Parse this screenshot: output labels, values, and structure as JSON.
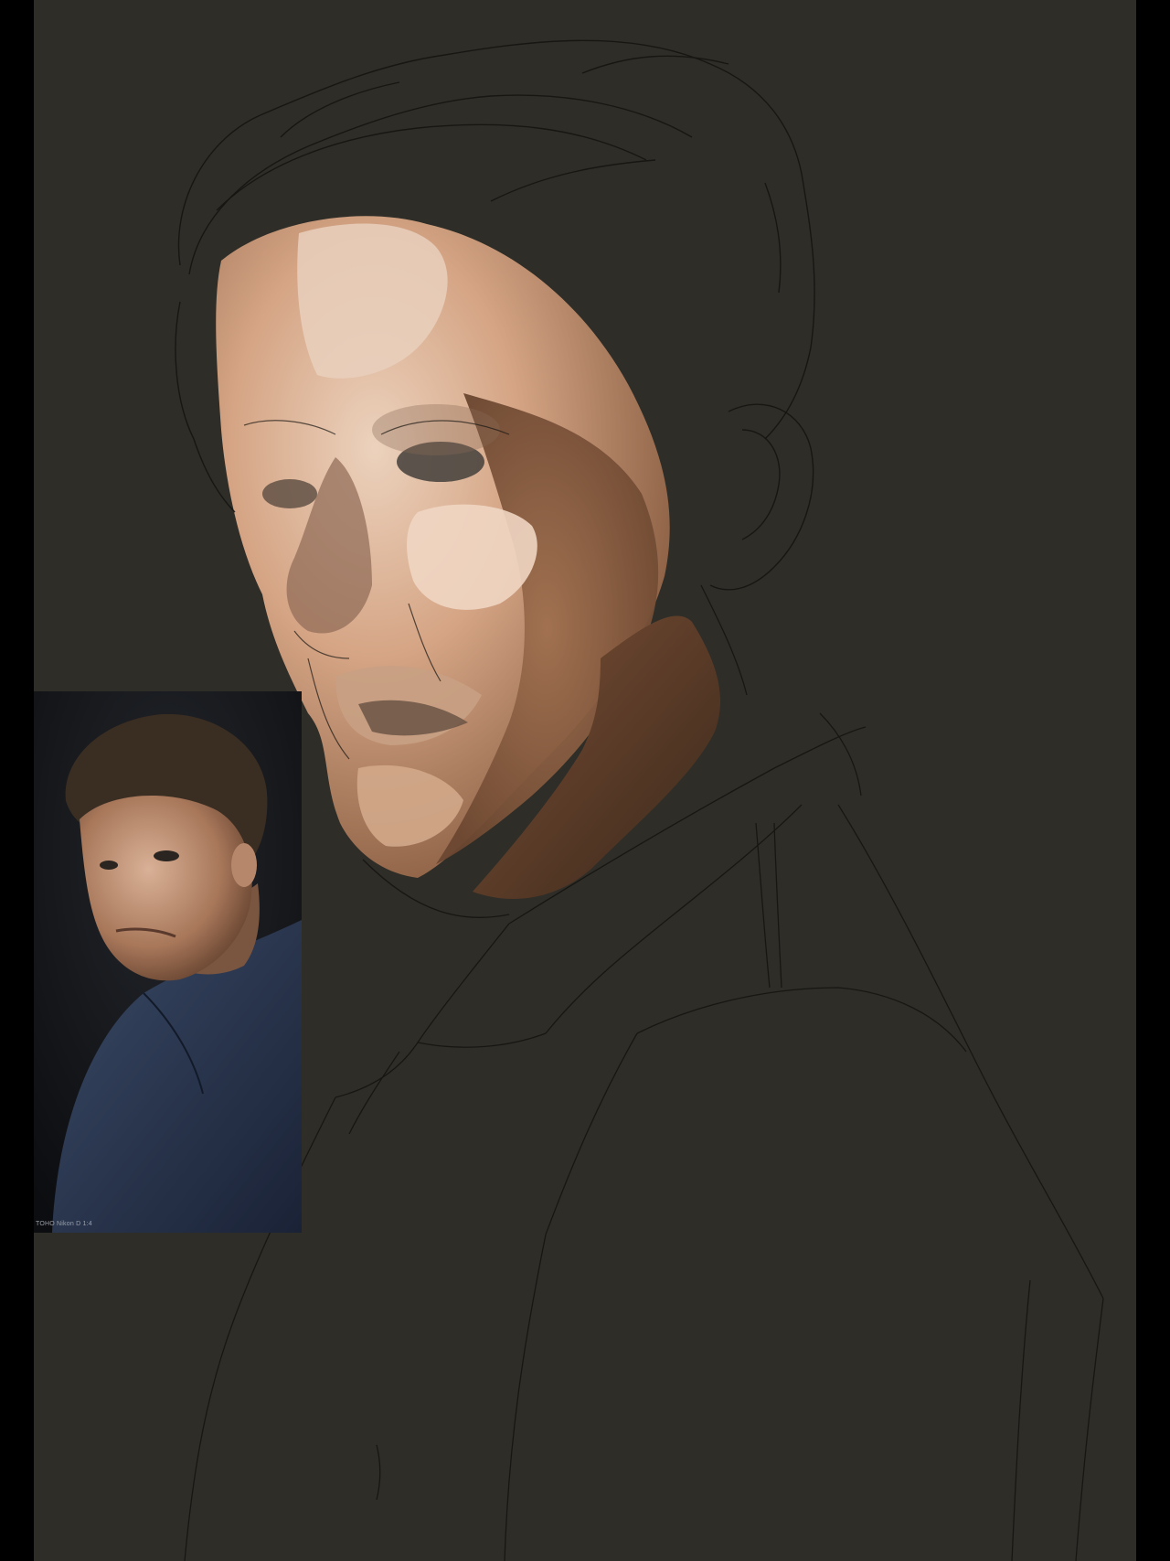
{
  "canvas": {
    "background_color": "#2e2d27",
    "letterbox_color": "#000000"
  },
  "painting": {
    "subject": "digital portrait painting in progress over a line sketch",
    "palette": [
      "#e8c9b0",
      "#d9a888",
      "#a97a5c",
      "#6e4a34",
      "#4a3020",
      "#1e1d19"
    ]
  },
  "reference_photo": {
    "caption": "TOHO Nikon D 1:4",
    "icon": "reference-photo-icon"
  }
}
